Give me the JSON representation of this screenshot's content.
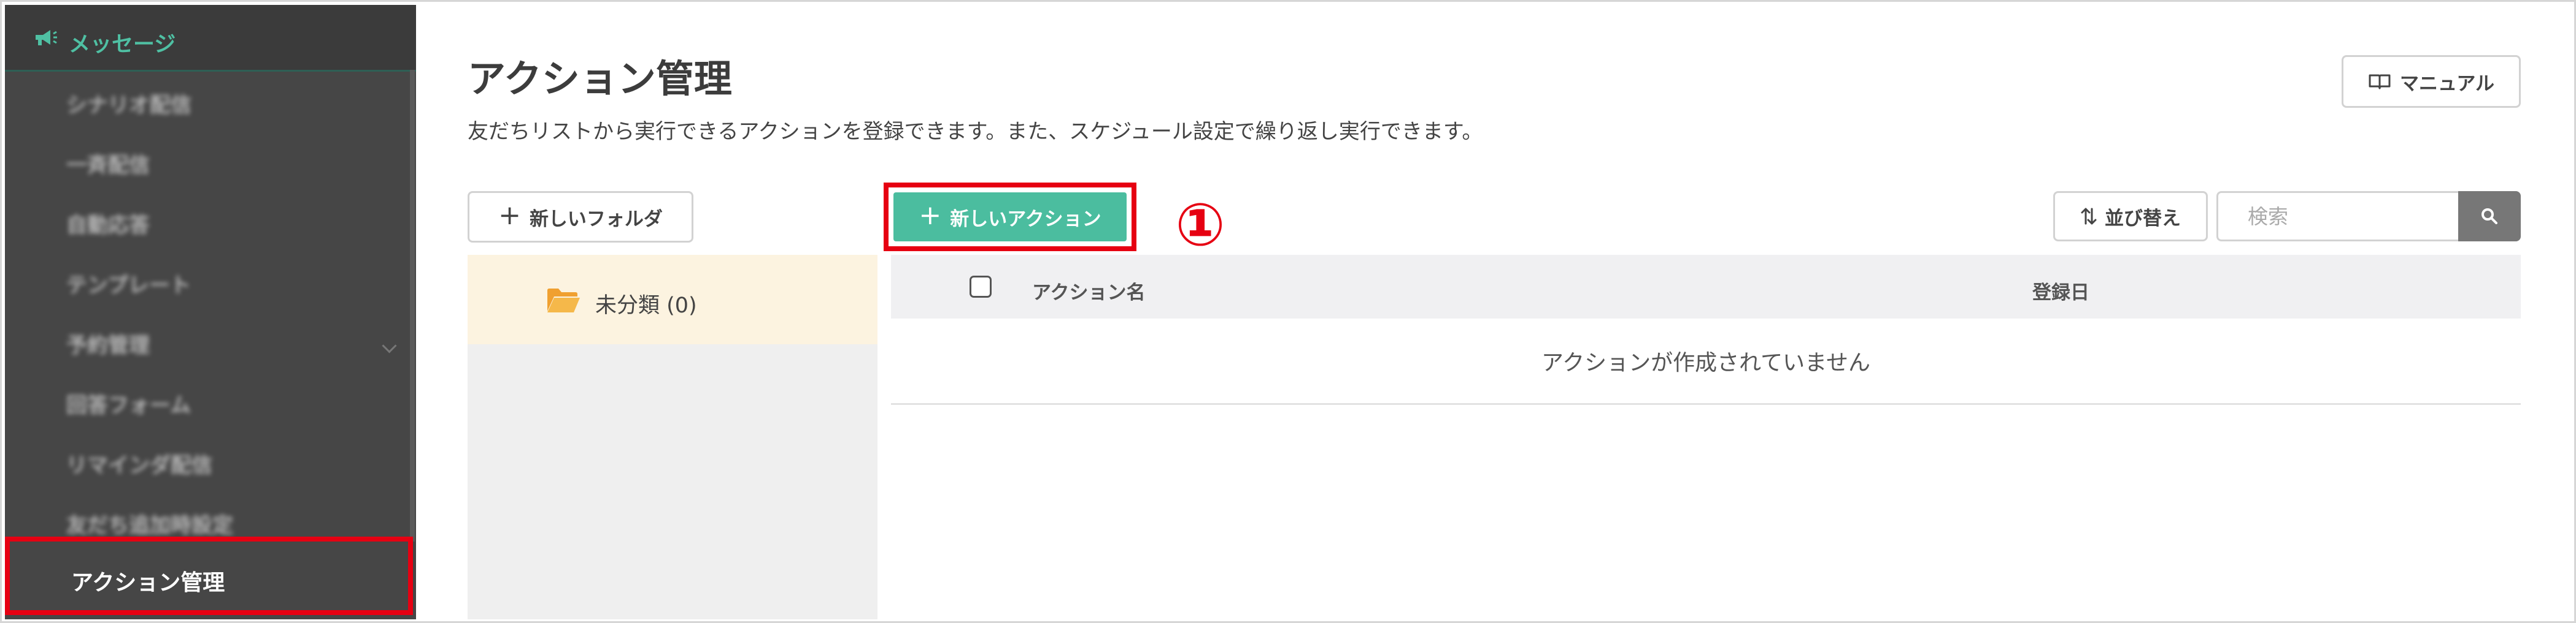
{
  "sidebar": {
    "section_title": "メッセージ",
    "items": [
      {
        "label": "シナリオ配信"
      },
      {
        "label": "一斉配信"
      },
      {
        "label": "自動応答"
      },
      {
        "label": "テンプレート"
      },
      {
        "label": "予約管理"
      },
      {
        "label": "回答フォーム"
      },
      {
        "label": "リマインダ配信"
      },
      {
        "label": "友だち追加時設定"
      }
    ],
    "active_item": "アクション管理"
  },
  "header": {
    "title": "アクション管理",
    "description": "友だちリストから実行できるアクションを登録できます。また、スケジュール設定で繰り返し実行できます。",
    "manual_label": "マニュアル"
  },
  "toolbar": {
    "new_folder_label": "新しいフォルダ",
    "new_action_label": "新しいアクション",
    "callout": "①",
    "sort_label": "並び替え",
    "search_placeholder": "検索"
  },
  "folders": [
    {
      "label": "未分類 (0)"
    }
  ],
  "table": {
    "columns": [
      "アクション名",
      "登録日"
    ],
    "empty_message": "アクションが作成されていません"
  },
  "colors": {
    "accent": "#4bbd9f",
    "highlight": "#e60012",
    "sidebar_bg": "#464646",
    "folder_selected_bg": "#fcf3e0"
  }
}
